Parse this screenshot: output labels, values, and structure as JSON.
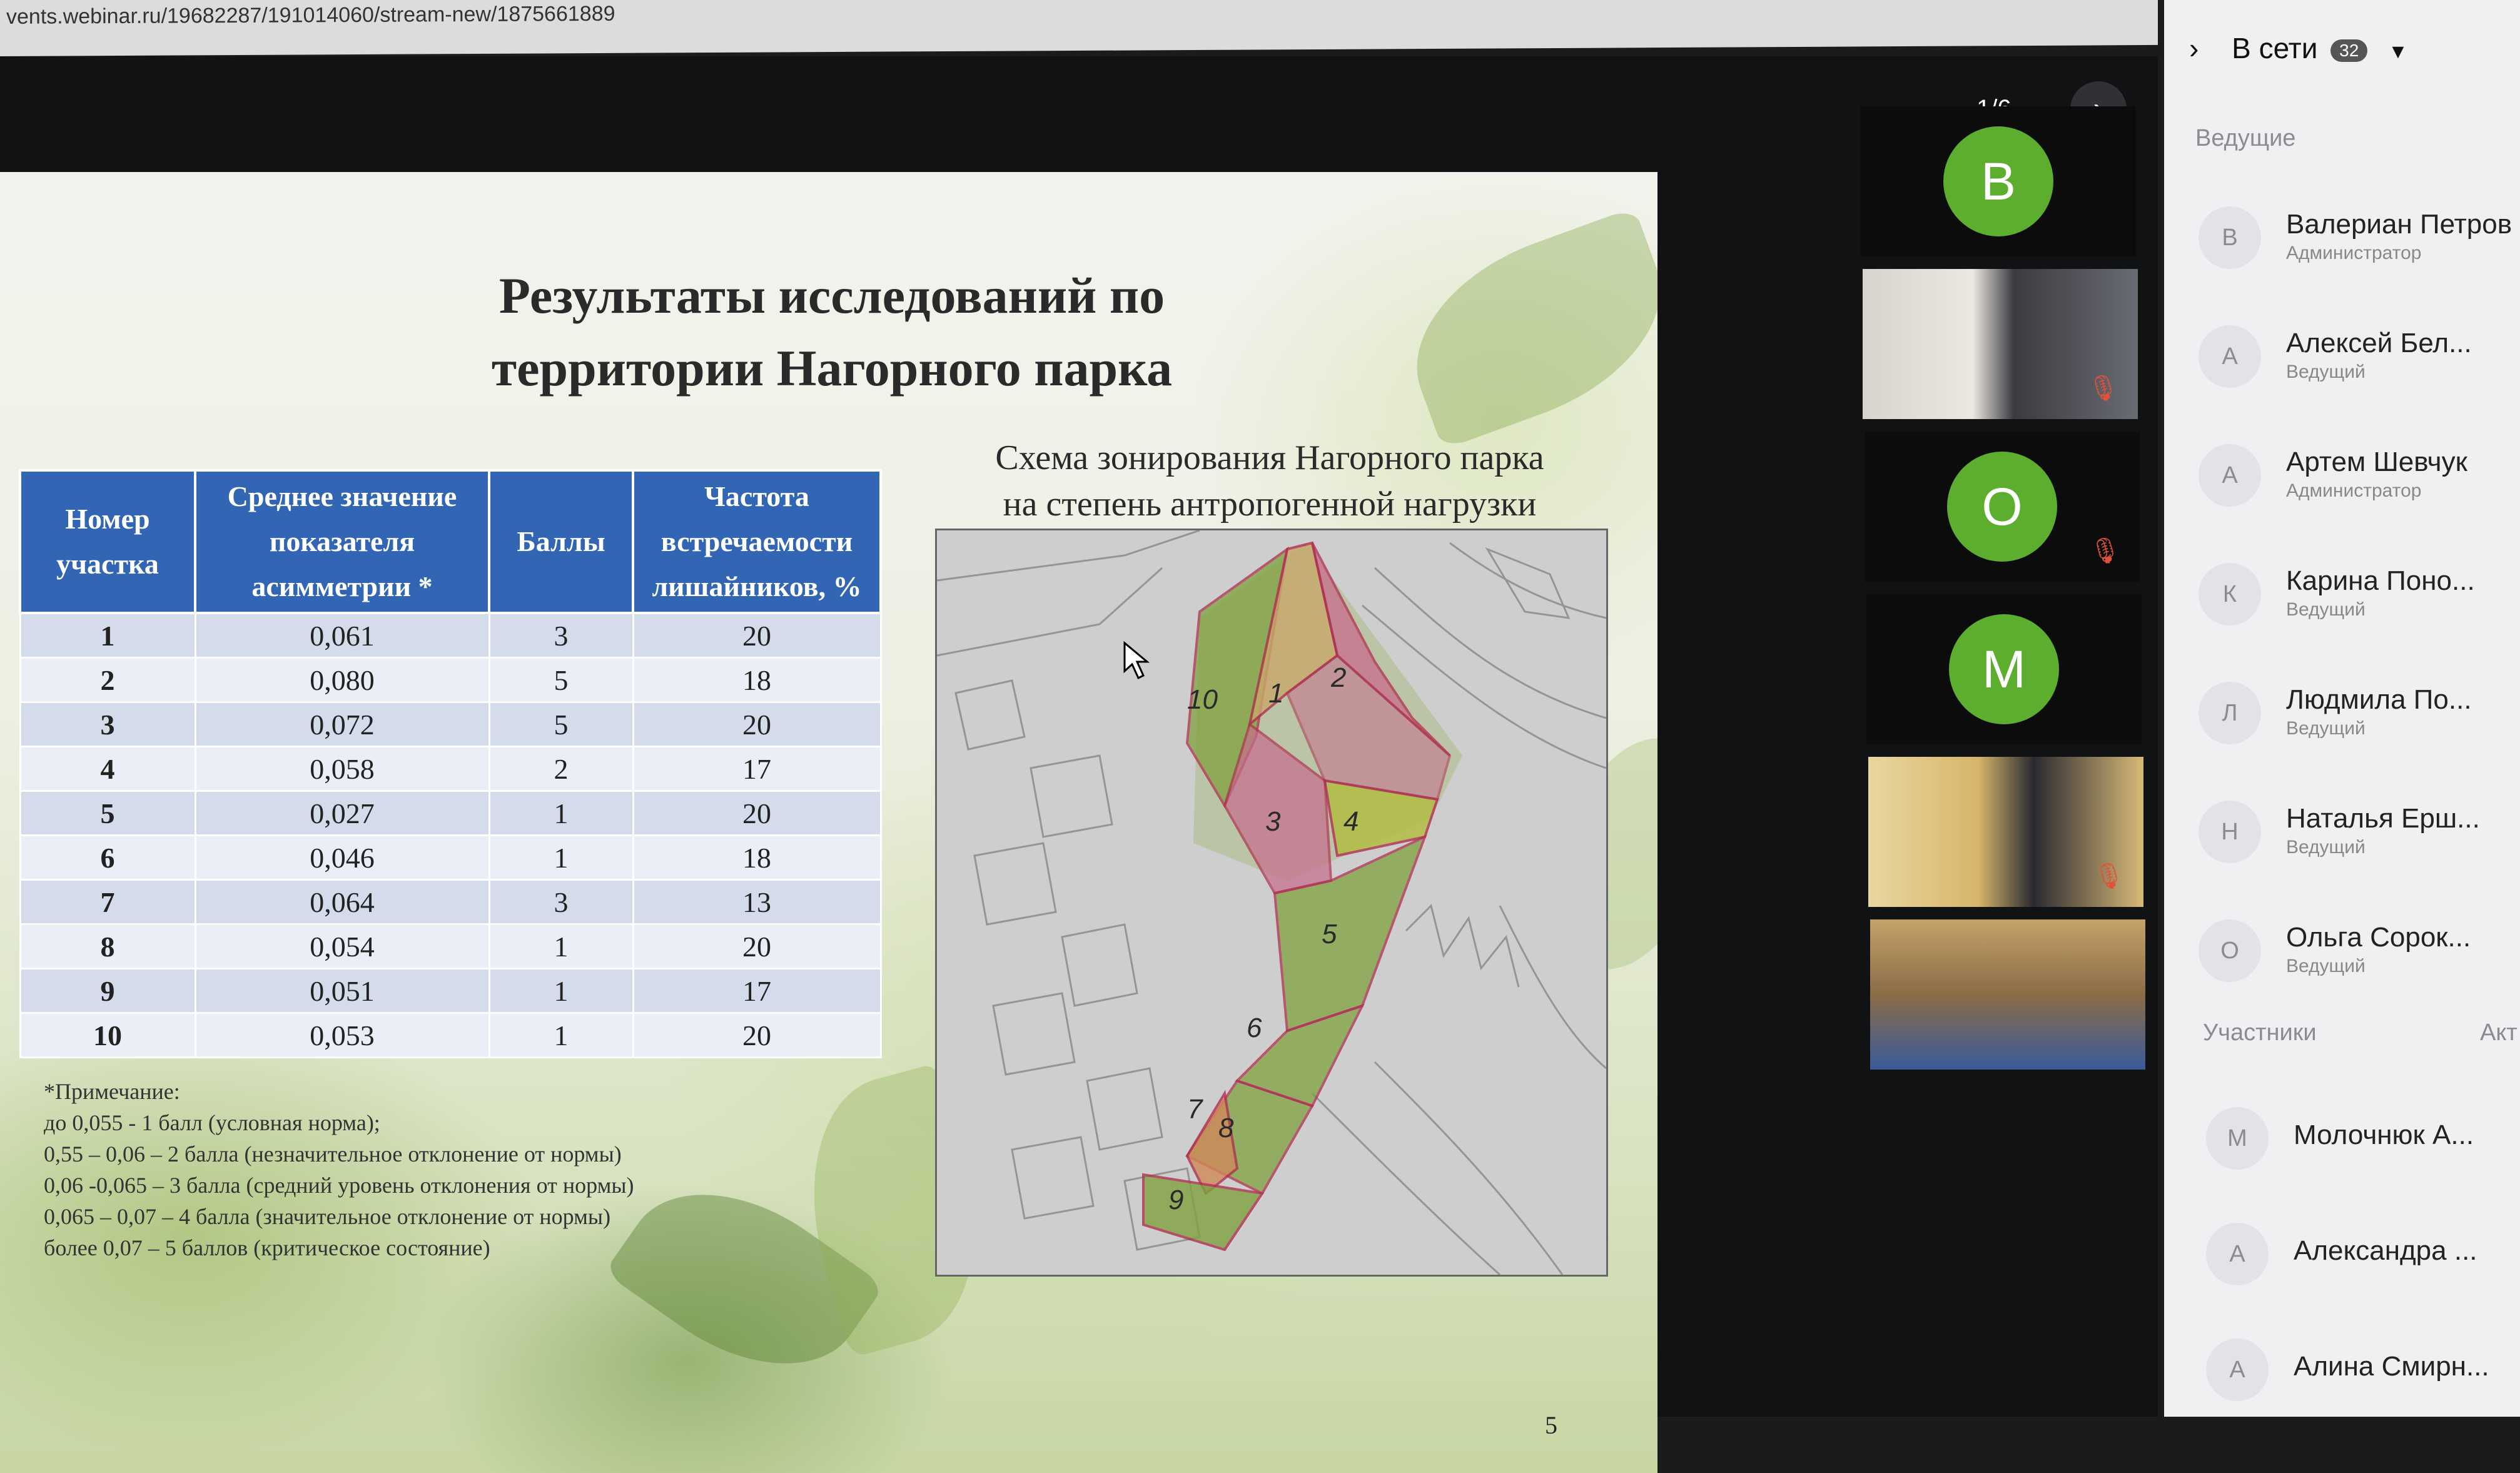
{
  "browser": {
    "url": "vents.webinar.ru/19682287/191014060/stream-new/1875661889"
  },
  "viewer": {
    "page_counter": "1/6",
    "next_icon": "chevron-right-icon"
  },
  "slide": {
    "title_line1": "Результаты исследований по",
    "title_line2": "территории Нагорного парка",
    "map_caption_line1": "Схема зонирования Нагорного парка",
    "map_caption_line2": "на степень антропогенной нагрузки",
    "page_number": "5",
    "table": {
      "headers": [
        "Номер участка",
        "Среднее значение показателя асимметрии *",
        "Баллы",
        "Частота встречаемости лишайников, %"
      ],
      "rows": [
        {
          "num": "1",
          "value": "0,061",
          "score": "3",
          "freq": "20"
        },
        {
          "num": "2",
          "value": "0,080",
          "score": "5",
          "freq": "18"
        },
        {
          "num": "3",
          "value": "0,072",
          "score": "5",
          "freq": "20"
        },
        {
          "num": "4",
          "value": "0,058",
          "score": "2",
          "freq": "17"
        },
        {
          "num": "5",
          "value": "0,027",
          "score": "1",
          "freq": "20"
        },
        {
          "num": "6",
          "value": "0,046",
          "score": "1",
          "freq": "18"
        },
        {
          "num": "7",
          "value": "0,064",
          "score": "3",
          "freq": "13"
        },
        {
          "num": "8",
          "value": "0,054",
          "score": "1",
          "freq": "20"
        },
        {
          "num": "9",
          "value": "0,051",
          "score": "1",
          "freq": "17"
        },
        {
          "num": "10",
          "value": "0,053",
          "score": "1",
          "freq": "20"
        }
      ]
    },
    "note": [
      "*Примечание:",
      "до 0,055 - 1 балл (условная норма);",
      "0,55 – 0,06 – 2 балла (незначительное отклонение от нормы)",
      "0,06 -0,065 – 3 балла (средний уровень отклонения от нормы)",
      "0,065 – 0,07 – 4 балла (значительное отклонение от нормы)",
      "более 0,07 – 5 баллов (критическое состояние)"
    ],
    "map_labels": [
      "10",
      "1",
      "2",
      "3",
      "4",
      "5",
      "6",
      "7",
      "8",
      "9"
    ],
    "zone_colors": {
      "score1": "#7fa23e",
      "score2": "#b2bc3c",
      "score3": "#c9a86a",
      "score5": "#c76d8d"
    }
  },
  "video_tiles": [
    {
      "letter": "В",
      "muted": false
    },
    {
      "letter": "",
      "muted": true
    },
    {
      "letter": "О",
      "muted": true
    },
    {
      "letter": "М",
      "muted": false
    },
    {
      "letter": "",
      "muted": true
    },
    {
      "letter": "",
      "muted": false
    }
  ],
  "avatar_color": "#5dae2f",
  "panel": {
    "online_label": "В сети",
    "online_count": "32",
    "collapse_icon": "chevron-right-icon",
    "dropdown_icon": "caret-down-icon",
    "hosts_title": "Ведущие",
    "participants_title": "Участники",
    "participants_tab_cut": "Акт",
    "hosts": [
      {
        "initial": "В",
        "name": "Валериан Петров",
        "role": "Администратор"
      },
      {
        "initial": "А",
        "name": "Алексей Бел...",
        "role": "Ведущий"
      },
      {
        "initial": "А",
        "name": "Артем Шевчук",
        "role": "Администратор"
      },
      {
        "initial": "К",
        "name": "Карина Поно...",
        "role": "Ведущий"
      },
      {
        "initial": "Л",
        "name": "Людмила По...",
        "role": "Ведущий"
      },
      {
        "initial": "Н",
        "name": "Наталья Ерш...",
        "role": "Ведущий"
      },
      {
        "initial": "О",
        "name": "Ольга Сорок...",
        "role": "Ведущий"
      }
    ],
    "participants": [
      {
        "initial": "М",
        "name": "Молочнюк А..."
      },
      {
        "initial": "А",
        "name": "Александра ..."
      },
      {
        "initial": "А",
        "name": "Алина Смирн..."
      }
    ]
  }
}
